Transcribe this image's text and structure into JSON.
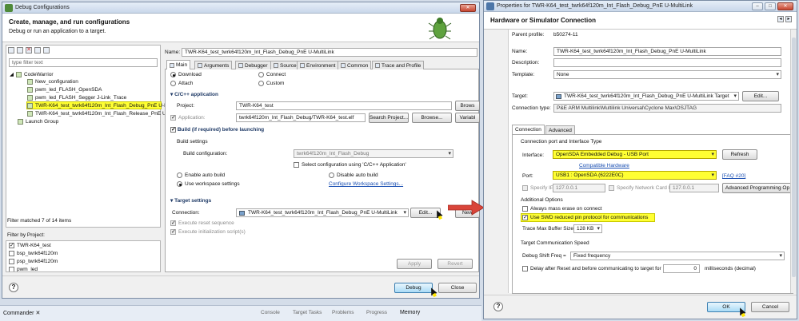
{
  "debug_window": {
    "title": "Debug Configurations",
    "header_title": "Create, manage, and run configurations",
    "header_subtitle": "Debug or run an application to a target.",
    "filter_placeholder": "type filter text",
    "tree": {
      "root": "CodeWarrior",
      "items": [
        "New_configuration",
        "pwm_led_FLASH_OpenSDA",
        "pwm_led_FLASH_Segger J-Link_Trace",
        "TWR-K64_test_twrk64f120m_Int_Flash_Debug_PnE U-M",
        "TWR-K64_test_twrk64f120m_Int_Flash_Release_PnE U-M"
      ],
      "launch_group": "Launch Group"
    },
    "filter_status": "Filter matched 7 of 14 items",
    "filter_by_project_label": "Filter by Project:",
    "projects": [
      "TWR-K64_test",
      "bsp_twrk64f120m",
      "psp_twrk64f120m",
      "pwm_led"
    ],
    "name_label": "Name:",
    "name_value": "TWR-K64_test_twrk64f120m_Int_Flash_Debug_PnE U-MultiLink",
    "tabs": [
      "Main",
      "Arguments",
      "Debugger",
      "Source",
      "Environment",
      "Common",
      "Trace and Profile"
    ],
    "mode": {
      "download": "Download",
      "attach": "Attach",
      "connect": "Connect",
      "custom": "Custom"
    },
    "cpp_section": "C/C++ application",
    "project_label": "Project:",
    "project_value": "TWR-K64_test",
    "browse": "Brows",
    "application_label": "Application:",
    "application_value": "twrk64f120m_Int_Flash_Debug/TWR-K64_test.elf",
    "search_project": "Search Project...",
    "browse2": "Browse...",
    "variables": "Variabl",
    "build_section": "Build (if required) before launching",
    "build_settings_label": "Build settings",
    "build_config_label": "Build configuration:",
    "build_config_value": "twrk64f120m_Int_Flash_Debug",
    "select_config": "Select configuration using 'C/C++ Application'",
    "enable_auto": "Enable auto build",
    "disable_auto": "Disable auto build",
    "use_workspace": "Use workspace settings",
    "configure_workspace": "Configure Workspace Settings...",
    "target_section": "Target settings",
    "connection_label": "Connection:",
    "connection_value": "TWR-K64_test_twrk64f120m_Int_Flash_Debug_PnE U-MultiLink",
    "edit": "Edit...",
    "new": "New",
    "reset_seq": "Execute reset sequence",
    "init_scripts": "Execute initialization script(s)",
    "apply": "Apply",
    "revert": "Revert",
    "debug": "Debug",
    "close": "Close"
  },
  "bottom_bar": {
    "commander": "Commander",
    "console": "Console",
    "target_tasks": "Target Tasks",
    "problems": "Problems",
    "progress": "Progress",
    "memory": "Memory"
  },
  "props_window": {
    "title": "Properties for TWR-K64_test_twrk64f120m_Int_Flash_Debug_PnE U-MultiLink",
    "header_title": "Hardware or Simulator Connection",
    "parent_profile_label": "Parent profile:",
    "parent_profile_value": "b50274-11",
    "name_label": "Name:",
    "name_value": "TWR-K64_test_twrk64f120m_Int_Flash_Debug_PnE U-MultiLink",
    "description_label": "Description:",
    "template_label": "Template:",
    "template_value": "None",
    "target_label": "Target:",
    "target_value": "TWR-K64_test_twrk64f120m_Int_Flash_Debug_PnE U-MultiLink Target",
    "edit": "Edit...",
    "conn_type_label": "Connection type:",
    "conn_type_value": "P&E ARM Multilink\\Multilink Universal\\Cyclone Max\\OSJTAG",
    "tabs": [
      "Connection",
      "Advanced"
    ],
    "conn_port_section": "Connection port and Interface Type",
    "interface_label": "Interface:",
    "interface_value": "OpenSDA Embedded Debug - USB Port",
    "refresh": "Refresh",
    "compatible_hw": "Compatible Hardware",
    "port_label": "Port:",
    "port_value": "USB1 : OpenSDA (6222E0C)",
    "faq": "[FAQ #20]",
    "specify_ip": "Specify IP",
    "ip_value": "127.0.0.1",
    "specify_nic": "Specify Network Card IP",
    "nic_value": "127.0.0.1",
    "adv_prog": "Advanced Programming Op",
    "additional_section": "Additional Options",
    "always_mass": "Always mass erase on connect",
    "use_swd": "Use SWD reduced pin protocol for communications",
    "trace_buf_label": "Trace Max Buffer Size:",
    "trace_buf_value": "128 KB",
    "target_comm_section": "Target Communication Speed",
    "shift_freq_label": "Debug Shift Freq =",
    "shift_freq_value": "Fixed frequency",
    "delay_label": "Delay after Reset and before communicating to target for",
    "delay_value": "0",
    "delay_unit": "milliseconds (decimal)",
    "ok": "OK",
    "cancel": "Cancel"
  },
  "colors": {
    "highlight": "#ffff33",
    "arrow": "#d9453a",
    "link": "#1a4fb2"
  }
}
